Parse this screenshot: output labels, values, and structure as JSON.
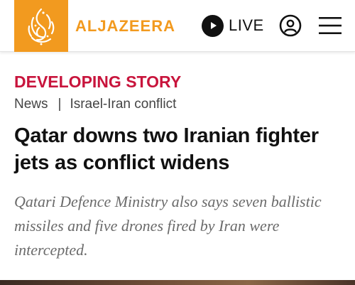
{
  "header": {
    "logo_text": "ALJAZEERA",
    "live_label": "LIVE",
    "icons": {
      "logo": "aljazeera-logo-mark",
      "live": "play-icon",
      "account": "user-icon",
      "menu": "hamburger-menu-icon"
    },
    "brand_color": "#f29a1f"
  },
  "article": {
    "kicker": "DEVELOPING STORY",
    "kicker_color": "#c8143c",
    "breadcrumb": {
      "section": "News",
      "separator": "|",
      "topic": "Israel-Iran conflict"
    },
    "headline": "Qatar downs two Iranian fighter jets as conflict widens",
    "standfirst": "Qatari Defence Ministry also says seven ballistic missiles and five drones fired by Iran were intercepted."
  }
}
